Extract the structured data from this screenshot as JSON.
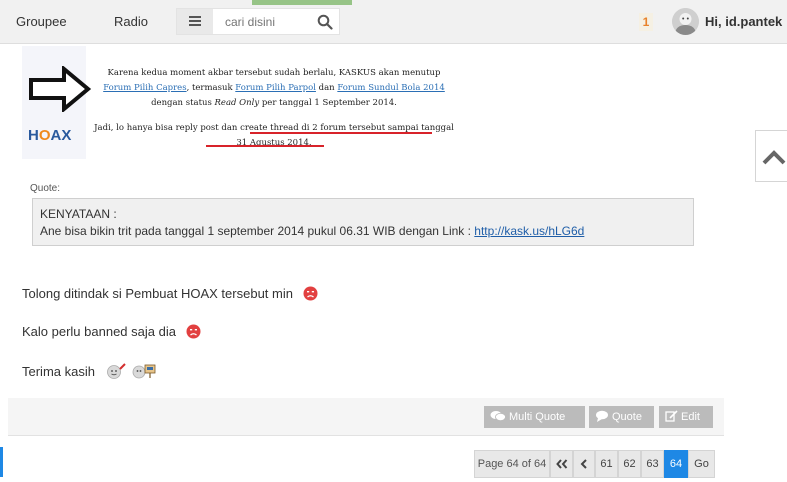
{
  "nav": {
    "groupee": "Groupee",
    "radio": "Radio",
    "search_placeholder": "cari disini",
    "notification_count": "1",
    "greeting": "Hi, id.pantek"
  },
  "post_image": {
    "logo": "HOAX",
    "p1_a": "Karena kedua moment akbar tersebut sudah berlalu, KASKUS akan menutup",
    "link1": "Forum Pilih Capres",
    "p1_b": ", termasuk",
    "link2": "Forum Pilih Parpol",
    "p1_c": "dan",
    "link3": "Forum Sundul Bola 2014",
    "p1_d": "dengan status",
    "read_only": "Read Only",
    "p1_e": "per tanggal 1 September 2014.",
    "p2_a": "Jadi, lo hanya bisa reply post dan",
    "p2_b": "create thread di 2 forum tersebut sampai tanggal 31 Agustus 2014."
  },
  "quote": {
    "label": "Quote:",
    "line1": "KENYATAAN :",
    "line2": "Ane bisa bikin trit pada tanggal 1 september 2014 pukul 06.31 WIB dengan Link :",
    "link": "http://kask.us/hLG6d"
  },
  "messages": {
    "line1": "Tolong ditindak si Pembuat HOAX tersebut min",
    "line2": "Kalo perlu banned saja dia",
    "line3": "Terima kasih"
  },
  "post_actions": {
    "multi_quote": "Multi Quote",
    "quote": "Quote",
    "edit": "Edit"
  },
  "pagination": {
    "info": "Page 64 of 64",
    "pages": [
      "61",
      "62",
      "63",
      "64"
    ],
    "current": "64",
    "go": "Go"
  },
  "colors": {
    "accent_blue": "#1e88e5",
    "link_blue": "#1f5ea8",
    "notif_orange": "#e8822b",
    "underline_red": "#d8232a"
  }
}
